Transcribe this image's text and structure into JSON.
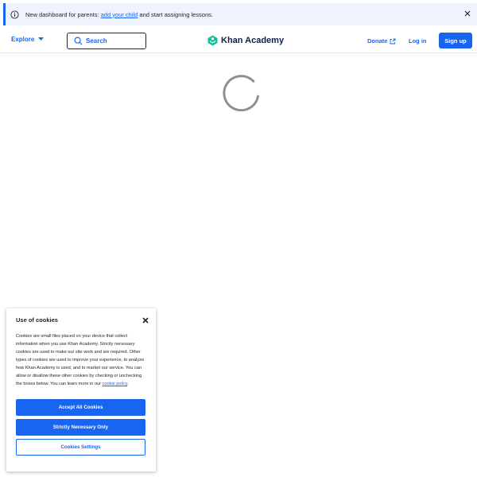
{
  "banner": {
    "text_before": "New dashboard for parents: ",
    "link_text": "add your child",
    "text_after": " and start assigning lessons."
  },
  "nav": {
    "explore_label": "Explore",
    "search_label": "Search",
    "logo_text": "Khan Academy",
    "donate_label": "Donate",
    "login_label": "Log in",
    "signup_label": "Sign up"
  },
  "cookie": {
    "title": "Use of cookies",
    "body": "Cookies are small files placed on your device that collect information when you use Khan Academy. Strictly necessary cookies are used to make our site work and are required. Other types of cookies are used to improve your experience, to analyze how Khan Academy is used, and to market our service. You can allow or disallow these other cookies by checking or unchecking the boxes below. You can learn more in our ",
    "policy_link": "cookie policy",
    "policy_end": ".",
    "accept_all": "Accept All Cookies",
    "strictly": "Strictly Necessary Only",
    "settings": "Cookies Settings"
  },
  "colors": {
    "brand_blue": "#1865f2",
    "banner_bg": "#eef3fe",
    "logo_green": "#14bf96",
    "text": "#21242c"
  }
}
